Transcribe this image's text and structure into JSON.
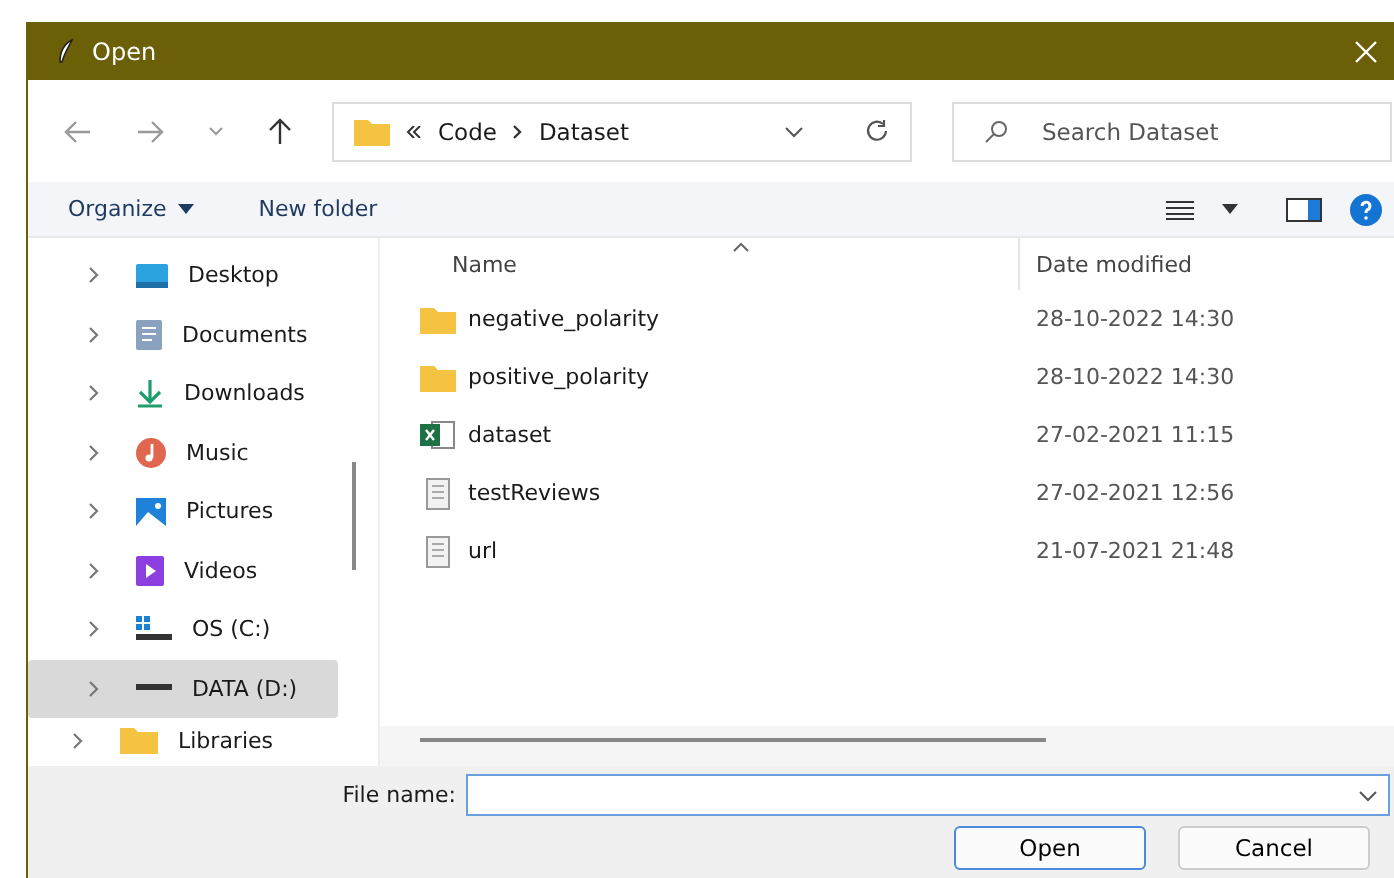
{
  "window": {
    "title": "Open"
  },
  "address": {
    "segments": [
      "Code",
      "Dataset"
    ]
  },
  "search": {
    "placeholder": "Search Dataset"
  },
  "toolbar": {
    "organize": "Organize",
    "new_folder": "New folder"
  },
  "sidebar": {
    "items": [
      {
        "label": "Desktop",
        "kind": "desktop",
        "selected": false
      },
      {
        "label": "Documents",
        "kind": "documents",
        "selected": false
      },
      {
        "label": "Downloads",
        "kind": "downloads",
        "selected": false
      },
      {
        "label": "Music",
        "kind": "music",
        "selected": false
      },
      {
        "label": "Pictures",
        "kind": "pictures",
        "selected": false
      },
      {
        "label": "Videos",
        "kind": "videos",
        "selected": false
      },
      {
        "label": "OS (C:)",
        "kind": "osdrive",
        "selected": false
      },
      {
        "label": "DATA (D:)",
        "kind": "drive",
        "selected": true
      },
      {
        "label": "Libraries",
        "kind": "libraries",
        "selected": false
      }
    ]
  },
  "table": {
    "columns": [
      "Name",
      "Date modified"
    ],
    "rows": [
      {
        "name": "negative_polarity",
        "date": "28-10-2022 14:30",
        "kind": "folder"
      },
      {
        "name": "positive_polarity",
        "date": "28-10-2022 14:30",
        "kind": "folder"
      },
      {
        "name": "dataset",
        "date": "27-02-2021 11:15",
        "kind": "excel"
      },
      {
        "name": "testReviews",
        "date": "27-02-2021 12:56",
        "kind": "text"
      },
      {
        "name": "url",
        "date": "21-07-2021 21:48",
        "kind": "text"
      }
    ]
  },
  "file_name": {
    "label": "File name:"
  },
  "buttons": [
    "Open",
    "Cancel"
  ]
}
